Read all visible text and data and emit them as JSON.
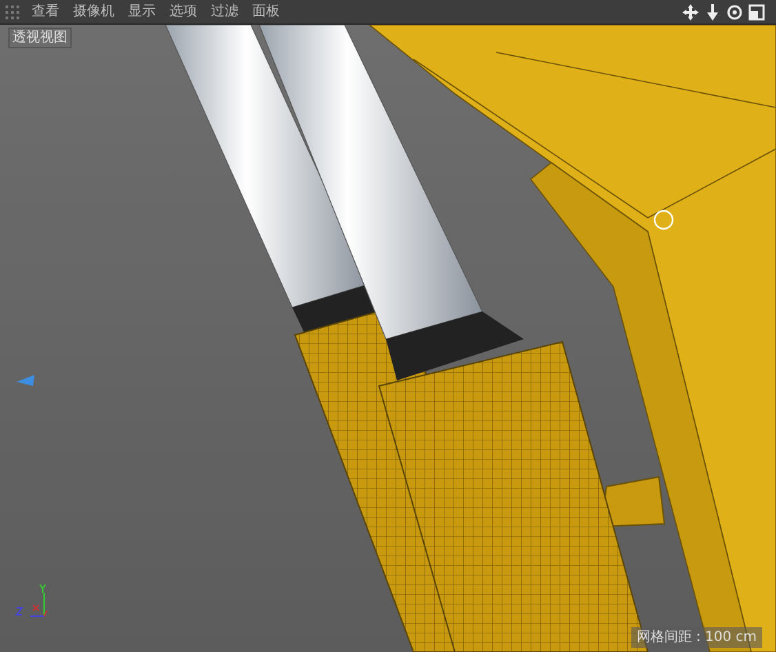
{
  "menu": [
    {
      "label": "查看"
    },
    {
      "label": "摄像机"
    },
    {
      "label": "显示"
    },
    {
      "label": "选项"
    },
    {
      "label": "过滤"
    },
    {
      "label": "面板"
    }
  ],
  "viewport": {
    "title": "透视视图",
    "grid_spacing": "网格间距 : 100 cm"
  }
}
